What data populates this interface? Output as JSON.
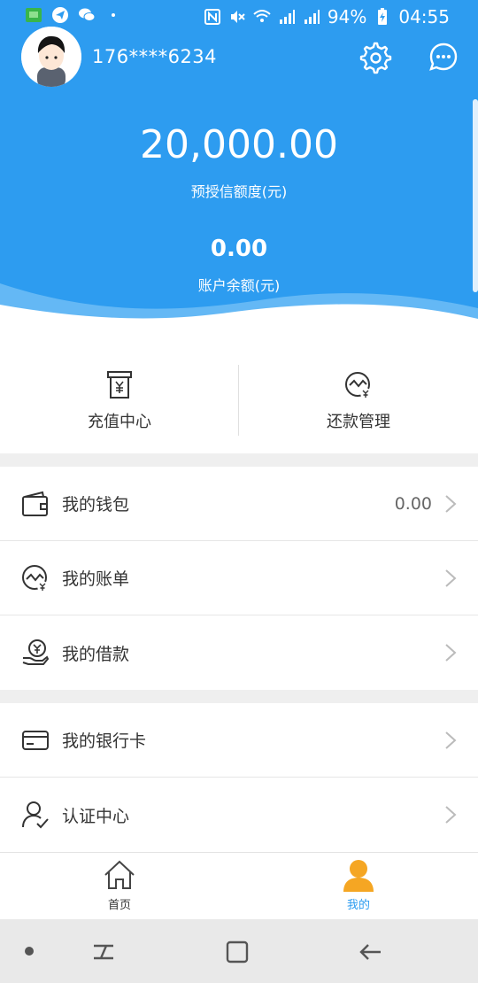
{
  "status_bar": {
    "battery": "94%",
    "time": "04:55",
    "icons": [
      "app-green-icon",
      "telegram-icon",
      "wechat-icon",
      "dot-icon",
      "nfc-icon",
      "mute-icon",
      "wifi-icon",
      "4g-signal-icon",
      "2g-signal-icon",
      "battery-charging-icon"
    ]
  },
  "user": {
    "phone": "176****6234"
  },
  "header": {
    "settings_icon": "gear-icon",
    "message_icon": "chat-bubble-icon",
    "credit_amount": "20,000.00",
    "credit_label": "预授信额度(元)",
    "balance_amount": "0.00",
    "balance_label": "账户余额(元)"
  },
  "quick_actions": [
    {
      "label": "充值中心",
      "icon": "recharge-icon"
    },
    {
      "label": "还款管理",
      "icon": "repayment-icon"
    }
  ],
  "menu_group_1": [
    {
      "label": "我的钱包",
      "value": "0.00",
      "icon": "wallet-icon"
    },
    {
      "label": "我的账单",
      "value": "",
      "icon": "bill-icon"
    },
    {
      "label": "我的借款",
      "value": "",
      "icon": "loan-icon"
    }
  ],
  "menu_group_2": [
    {
      "label": "我的银行卡",
      "icon": "bank-card-icon"
    },
    {
      "label": "认证中心",
      "icon": "verified-user-icon"
    }
  ],
  "tab_bar": [
    {
      "label": "首页",
      "icon": "home-icon",
      "active": false
    },
    {
      "label": "我的",
      "icon": "user-icon",
      "active": true
    }
  ],
  "colors": {
    "primary": "#2d9cf0",
    "active_tab_icon": "#f5a623",
    "text": "#333333"
  }
}
